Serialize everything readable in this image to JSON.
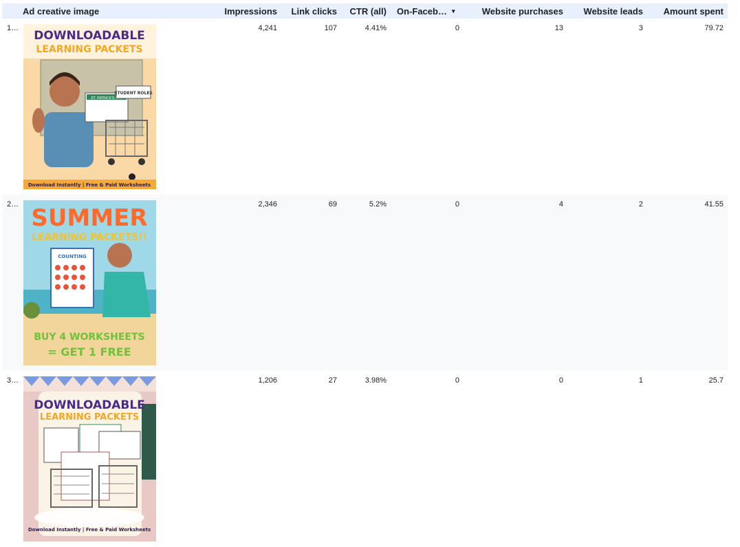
{
  "header": {
    "ad_creative_image": "Ad creative image",
    "impressions": "Impressions",
    "link_clicks": "Link clicks",
    "ctr_all": "CTR (all)",
    "on_facebook": "On-Faceb…",
    "sort_caret": "▾",
    "website_purchases": "Website purchases",
    "website_leads": "Website leads",
    "amount_spent": "Amount spent"
  },
  "rows": [
    {
      "index": "1…",
      "impressions": "4,241",
      "link_clicks": "107",
      "ctr_all": "4.41%",
      "on_facebook": "0",
      "website_purchases": "13",
      "website_leads": "3",
      "amount_spent": "79.72",
      "creative": {
        "title1": "DOWNLOADABLE",
        "title2": "LEARNING PACKETS",
        "footer": "Download Instantly | Free & Paid Worksheets",
        "tag1": "ST. PATRICK'S DAY",
        "tag2": "STUDENT ROLES"
      }
    },
    {
      "index": "2…",
      "impressions": "2,346",
      "link_clicks": "69",
      "ctr_all": "5.2%",
      "on_facebook": "0",
      "website_purchases": "4",
      "website_leads": "2",
      "amount_spent": "41.55",
      "creative": {
        "title1": "SUMMER",
        "title2": "LEARNING PACKETS!!",
        "line1": "BUY 4 WORKSHEETS",
        "line2": "= GET 1 FREE",
        "sheet": "COUNTING"
      }
    },
    {
      "index": "3…",
      "impressions": "1,206",
      "link_clicks": "27",
      "ctr_all": "3.98%",
      "on_facebook": "0",
      "website_purchases": "0",
      "website_leads": "1",
      "amount_spent": "25.7",
      "creative": {
        "title1": "DOWNLOADABLE",
        "title2": "LEARNING PACKETS",
        "footer": "Download Instantly | Free & Paid Worksheets"
      }
    }
  ],
  "colors": {
    "header_bg": "#e8f0fe",
    "alt_row_bg": "#f8f9fa",
    "purple_title": "#4b2a8a",
    "orange_title": "#f5a623",
    "summer_orange": "#ff6a2b"
  }
}
